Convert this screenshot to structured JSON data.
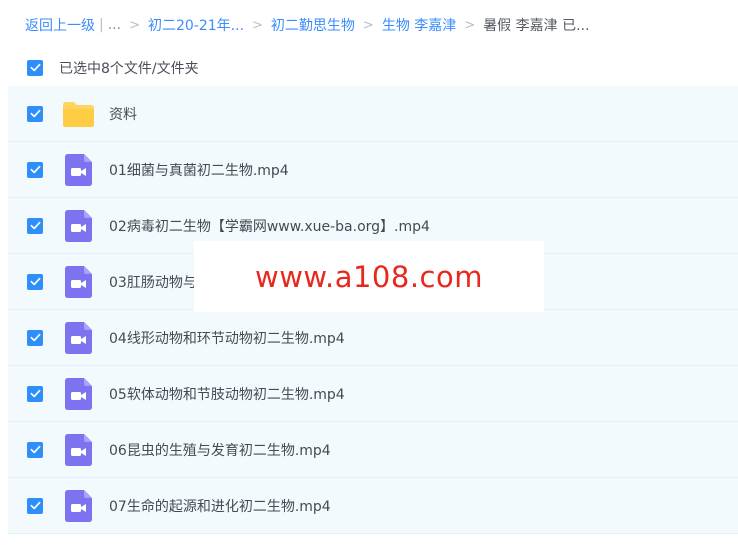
{
  "breadcrumb": {
    "back": "返回上一级",
    "ellipsis": "...",
    "items": [
      "初二20-21年...",
      "初二勤思生物",
      "生物 李嘉津"
    ],
    "current": "暑假 李嘉津 已..."
  },
  "select_all": {
    "label": "已选中8个文件/文件夹",
    "checked": true
  },
  "files": [
    {
      "name": "资料",
      "type": "folder",
      "checked": true
    },
    {
      "name": "01细菌与真菌初二生物.mp4",
      "type": "video",
      "checked": true
    },
    {
      "name": "02病毒初二生物【学霸网www.xue-ba.org】.mp4",
      "type": "video",
      "checked": true
    },
    {
      "name": "03肛肠动物与",
      "type": "video",
      "checked": true
    },
    {
      "name": "04线形动物和环节动物初二生物.mp4",
      "type": "video",
      "checked": true
    },
    {
      "name": "05软体动物和节肢动物初二生物.mp4",
      "type": "video",
      "checked": true
    },
    {
      "name": "06昆虫的生殖与发育初二生物.mp4",
      "type": "video",
      "checked": true
    },
    {
      "name": "07生命的起源和进化初二生物.mp4",
      "type": "video",
      "checked": true
    }
  ],
  "watermark": "www.a108.com",
  "icons": {
    "checkbox": "checkbox-checked-icon",
    "folder": "folder-icon",
    "video": "video-file-icon"
  },
  "colors": {
    "link": "#3b8cff",
    "checkbox": "#2f8ef7",
    "row_background": "#f3fafe",
    "folder": "#ffd55e",
    "video": "#7d73f0",
    "watermark": "#e8281d"
  }
}
